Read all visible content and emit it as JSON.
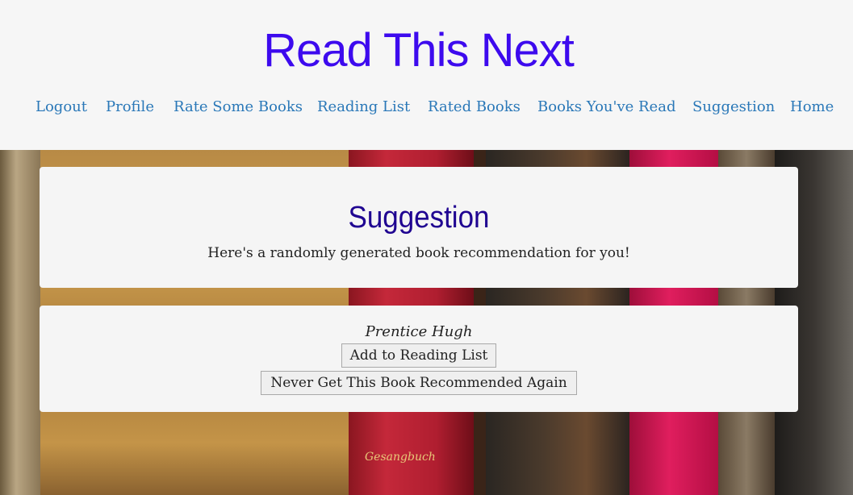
{
  "header": {
    "site_title": "Read This Next",
    "title_color": "#3d0aee",
    "nav": [
      {
        "label": "Logout"
      },
      {
        "label": "Profile"
      },
      {
        "label": "Rate Some Books"
      },
      {
        "label": "Reading List"
      },
      {
        "label": "Rated Books"
      },
      {
        "label": "Books You've Read"
      },
      {
        "label": "Suggestion"
      },
      {
        "label": "Home"
      }
    ],
    "nav_color": "#2a78b8"
  },
  "intro_panel": {
    "heading": "Suggestion",
    "subtitle": "Here's a randomly generated book recommendation for you!"
  },
  "suggestion_panel": {
    "book_title": "Prentice Hugh",
    "add_button": "Add to Reading List",
    "never_button": "Never Get This Book Recommended Again"
  },
  "background": {
    "image": "antique books on a shelf",
    "book_spine_text": "Gesangbuch"
  }
}
